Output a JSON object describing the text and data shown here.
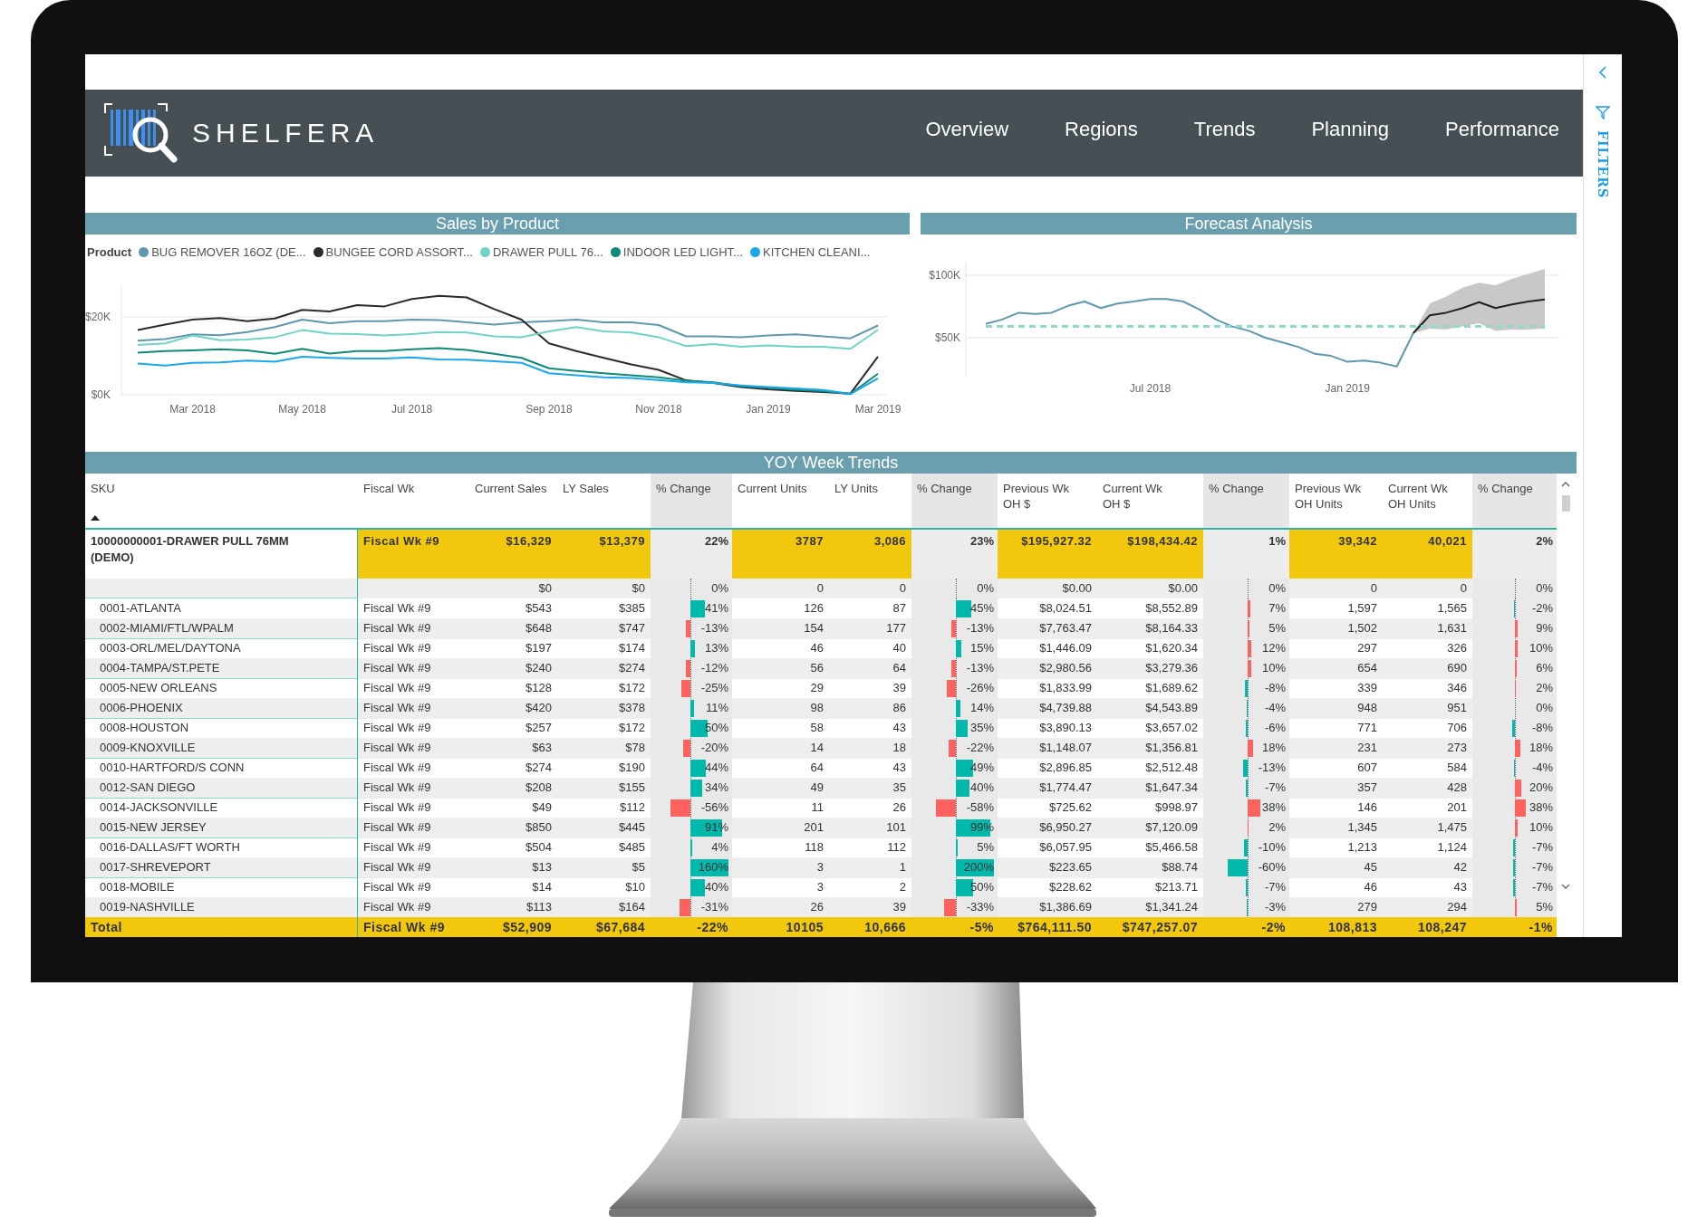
{
  "header": {
    "brand": "SHELFERA",
    "nav": [
      {
        "label": "Overview",
        "selected": false
      },
      {
        "label": "Regions",
        "selected": false
      },
      {
        "label": "Trends",
        "selected": false
      },
      {
        "label": "Planning",
        "selected": false
      },
      {
        "label": "Performance",
        "selected": false
      }
    ]
  },
  "side_panel": {
    "label": "FILTERS"
  },
  "sales_chart": {
    "title": "Sales by Product",
    "legend_title": "Product",
    "chart_data": {
      "type": "line",
      "categories": [
        null,
        null,
        "Mar 2018",
        null,
        null,
        null,
        "May 2018",
        null,
        null,
        null,
        "Jul 2018",
        null,
        null,
        null,
        null,
        "Sep 2018",
        null,
        null,
        null,
        "Nov 2018",
        null,
        null,
        null,
        "Jan 2019",
        null,
        null,
        null,
        "Mar 2019"
      ],
      "ylim": [
        0,
        28
      ],
      "yticks": [
        {
          "value": 0,
          "label": "$0K"
        },
        {
          "value": 20,
          "label": "$20K"
        }
      ],
      "series": [
        {
          "name": "BUG REMOVER 16OZ (DE...",
          "color": "#5f98ad",
          "values": [
            13.9,
            14.3,
            15.5,
            15.3,
            16.1,
            17.4,
            19.3,
            18.4,
            18.9,
            18.9,
            19.3,
            19.2,
            18.6,
            18,
            18.6,
            18.9,
            19.3,
            18.6,
            18.6,
            17.9,
            15,
            15,
            14.8,
            15.2,
            15.5,
            15,
            14.5,
            17.8
          ]
        },
        {
          "name": "BUNGEE CORD ASSORT...",
          "color": "#2b2b2b",
          "values": [
            16.6,
            18,
            19.3,
            19.7,
            18.9,
            19.6,
            21.8,
            21.4,
            23,
            22.7,
            24.6,
            25.4,
            25,
            22,
            19.3,
            13.2,
            11.2,
            9.5,
            7.8,
            6.4,
            3.7,
            3,
            2,
            1.4,
            1,
            0.7,
            0.3,
            9.8
          ]
        },
        {
          "name": "DRAWER PULL 76...",
          "color": "#6fd3c6",
          "values": [
            12.8,
            13.2,
            15.2,
            14,
            14.2,
            14.8,
            16.6,
            15.7,
            15.6,
            15.2,
            15.6,
            16.1,
            16,
            15,
            14.8,
            16.3,
            17.4,
            16.3,
            16,
            14.8,
            12.5,
            13,
            12.3,
            12.7,
            12.3,
            12.3,
            11.8,
            16.7
          ]
        },
        {
          "name": "INDOOR LED LIGHT...",
          "color": "#0f8a7a",
          "values": [
            10.8,
            11.2,
            11.4,
            11.7,
            11.4,
            10.5,
            11.8,
            10.6,
            11.2,
            11.2,
            11.7,
            12,
            11.5,
            10.5,
            9.5,
            6.8,
            6.1,
            5.5,
            5,
            4.5,
            3.6,
            3.2,
            2.2,
            1.8,
            1.3,
            0.9,
            0.2,
            5.4
          ]
        },
        {
          "name": "KITCHEN CLEANI...",
          "color": "#1aa7ec",
          "values": [
            8,
            7.5,
            8.2,
            8.3,
            8.8,
            8.5,
            9.8,
            9.5,
            9.3,
            9.3,
            9.6,
            9.1,
            9,
            8.6,
            8.2,
            5.5,
            5,
            4.5,
            4.3,
            3.8,
            3.2,
            3,
            2.4,
            2,
            1.6,
            1.2,
            0.2,
            4.2
          ]
        }
      ]
    }
  },
  "forecast_chart": {
    "title": "Forecast Analysis",
    "chart_data": {
      "type": "line",
      "categories": [
        null,
        null,
        null,
        null,
        null,
        null,
        null,
        null,
        null,
        null,
        "Jul 2018",
        null,
        null,
        null,
        null,
        null,
        null,
        null,
        null,
        null,
        null,
        null,
        "Jan 2019",
        null,
        null,
        null,
        null,
        null,
        null,
        null,
        null,
        null,
        null,
        null,
        null
      ],
      "ylim": [
        20,
        110
      ],
      "yticks": [
        {
          "value": 50,
          "label": "$50K"
        },
        {
          "value": 100,
          "label": "$100K"
        }
      ],
      "series": [
        {
          "color": "#5f98ad",
          "values": [
            61,
            64.6,
            70,
            69,
            70,
            75.5,
            79,
            73.7,
            77.4,
            79,
            81,
            81,
            79,
            72.6,
            64.6,
            59,
            55.5,
            50,
            46.4,
            42.7,
            37.2,
            35.4,
            30.7,
            31.7,
            30,
            27,
            53.6,
            null,
            null,
            null,
            null,
            null,
            null,
            null,
            null
          ]
        },
        {
          "color": "#222222",
          "values": [
            null,
            null,
            null,
            null,
            null,
            null,
            null,
            null,
            null,
            null,
            null,
            null,
            null,
            null,
            null,
            null,
            null,
            null,
            null,
            null,
            null,
            null,
            null,
            null,
            null,
            null,
            53.6,
            68,
            70,
            73.7,
            78.5,
            73.7,
            76.6,
            79,
            80.6
          ]
        },
        {
          "color": "#8fd8cc",
          "line_style": "dashed",
          "values": [
            59,
            59,
            59,
            59,
            59,
            59,
            59,
            59,
            59,
            59,
            59,
            59,
            59,
            59,
            59,
            59,
            59,
            59,
            59,
            59,
            59,
            59,
            59,
            59,
            59,
            59,
            59,
            59,
            59,
            59,
            59,
            59,
            59,
            59,
            59
          ]
        }
      ]
    }
  },
  "table": {
    "title": "YOY Week Trends",
    "columns": [
      {
        "label": "SKU",
        "kind": "text",
        "sorted": true
      },
      {
        "label": "Fiscal Wk",
        "kind": "text"
      },
      {
        "label": "Current Sales",
        "kind": "number"
      },
      {
        "label": "LY Sales",
        "kind": "number"
      },
      {
        "label": "% Change",
        "kind": "change",
        "inverted": false
      },
      {
        "label": "Current Units",
        "kind": "number"
      },
      {
        "label": "LY Units",
        "kind": "number"
      },
      {
        "label": "% Change",
        "kind": "change",
        "inverted": false
      },
      {
        "label": "Previous Wk\nOH $",
        "kind": "number"
      },
      {
        "label": "Current Wk\nOH $",
        "kind": "number"
      },
      {
        "label": "% Change",
        "kind": "change",
        "inverted": true
      },
      {
        "label": "Previous Wk\nOH Units",
        "kind": "number"
      },
      {
        "label": "Current Wk\nOH Units",
        "kind": "number"
      },
      {
        "label": "% Change",
        "kind": "change",
        "inverted": true
      }
    ],
    "rows": [
      {
        "kind": "group",
        "sku": "10000000001-DRAWER PULL 76MM (DEMO)",
        "fiscal_wk": "Fiscal Wk #9",
        "values": [
          "$16,329",
          "$13,379",
          {
            "text": "22%"
          },
          "3787",
          "3,086",
          {
            "text": "23%"
          },
          "$195,927.32",
          "$198,434.42",
          {
            "text": "1%"
          },
          "39,342",
          "40,021",
          {
            "text": "2%"
          }
        ]
      },
      {
        "kind": "detail",
        "values": [
          "$0",
          "$0",
          {
            "text": "0%"
          },
          "0",
          "0",
          {
            "text": "0%"
          },
          "$0.00",
          "$0.00",
          {
            "text": "0%"
          },
          "0",
          "0",
          {
            "text": "0%"
          }
        ]
      },
      {
        "kind": "detail",
        "sku": "0001-ATLANTA",
        "fiscal_wk": "Fiscal Wk #9",
        "values": [
          "$543",
          "$385",
          {
            "text": "41%",
            "negative": false
          },
          "126",
          "87",
          {
            "text": "45%",
            "negative": false
          },
          "$8,024.51",
          "$8,552.89",
          {
            "text": "7%",
            "negative": false
          },
          "1,597",
          "1,565",
          {
            "text": "-2%",
            "negative": true
          }
        ]
      },
      {
        "kind": "detail",
        "sku": "0002-MIAMI/FTL/WPALM",
        "fiscal_wk": "Fiscal Wk #9",
        "values": [
          "$648",
          "$747",
          {
            "text": "-13%",
            "negative": true
          },
          "154",
          "177",
          {
            "text": "-13%",
            "negative": true
          },
          "$7,763.47",
          "$8,164.33",
          {
            "text": "5%",
            "negative": false
          },
          "1,502",
          "1,631",
          {
            "text": "9%",
            "negative": false
          }
        ]
      },
      {
        "kind": "detail",
        "sku": "0003-ORL/MEL/DAYTONA",
        "fiscal_wk": "Fiscal Wk #9",
        "values": [
          "$197",
          "$174",
          {
            "text": "13%",
            "negative": false
          },
          "46",
          "40",
          {
            "text": "15%",
            "negative": false
          },
          "$1,446.09",
          "$1,620.34",
          {
            "text": "12%",
            "negative": false
          },
          "297",
          "326",
          {
            "text": "10%",
            "negative": false
          }
        ]
      },
      {
        "kind": "detail",
        "sku": "0004-TAMPA/ST.PETE",
        "fiscal_wk": "Fiscal Wk #9",
        "values": [
          "$240",
          "$274",
          {
            "text": "-12%",
            "negative": true
          },
          "56",
          "64",
          {
            "text": "-13%",
            "negative": true
          },
          "$2,980.56",
          "$3,279.36",
          {
            "text": "10%",
            "negative": false
          },
          "654",
          "690",
          {
            "text": "6%",
            "negative": false
          }
        ]
      },
      {
        "kind": "detail",
        "sku": "0005-NEW ORLEANS",
        "fiscal_wk": "Fiscal Wk #9",
        "values": [
          "$128",
          "$172",
          {
            "text": "-25%",
            "negative": true
          },
          "29",
          "39",
          {
            "text": "-26%",
            "negative": true
          },
          "$1,833.99",
          "$1,689.62",
          {
            "text": "-8%",
            "negative": true
          },
          "339",
          "346",
          {
            "text": "2%",
            "negative": false
          }
        ]
      },
      {
        "kind": "detail",
        "sku": "0006-PHOENIX",
        "fiscal_wk": "Fiscal Wk #9",
        "values": [
          "$420",
          "$378",
          {
            "text": "11%",
            "negative": false
          },
          "98",
          "86",
          {
            "text": "14%",
            "negative": false
          },
          "$4,739.88",
          "$4,543.89",
          {
            "text": "-4%",
            "negative": true
          },
          "948",
          "951",
          {
            "text": "0%"
          }
        ]
      },
      {
        "kind": "detail",
        "sku": "0008-HOUSTON",
        "fiscal_wk": "Fiscal Wk #9",
        "values": [
          "$257",
          "$172",
          {
            "text": "50%",
            "negative": false
          },
          "58",
          "43",
          {
            "text": "35%",
            "negative": false
          },
          "$3,890.13",
          "$3,657.02",
          {
            "text": "-6%",
            "negative": true
          },
          "771",
          "706",
          {
            "text": "-8%",
            "negative": true
          }
        ]
      },
      {
        "kind": "detail",
        "sku": "0009-KNOXVILLE",
        "fiscal_wk": "Fiscal Wk #9",
        "values": [
          "$63",
          "$78",
          {
            "text": "-20%",
            "negative": true
          },
          "14",
          "18",
          {
            "text": "-22%",
            "negative": true
          },
          "$1,148.07",
          "$1,356.81",
          {
            "text": "18%",
            "negative": false
          },
          "231",
          "273",
          {
            "text": "18%",
            "negative": false
          }
        ]
      },
      {
        "kind": "detail",
        "sku": "0010-HARTFORD/S CONN",
        "fiscal_wk": "Fiscal Wk #9",
        "values": [
          "$274",
          "$190",
          {
            "text": "44%",
            "negative": false
          },
          "64",
          "43",
          {
            "text": "49%",
            "negative": false
          },
          "$2,896.85",
          "$2,512.48",
          {
            "text": "-13%",
            "negative": true
          },
          "607",
          "584",
          {
            "text": "-4%",
            "negative": true
          }
        ]
      },
      {
        "kind": "detail",
        "sku": "0012-SAN DIEGO",
        "fiscal_wk": "Fiscal Wk #9",
        "values": [
          "$208",
          "$155",
          {
            "text": "34%",
            "negative": false
          },
          "49",
          "35",
          {
            "text": "40%",
            "negative": false
          },
          "$1,774.47",
          "$1,647.34",
          {
            "text": "-7%",
            "negative": true
          },
          "357",
          "428",
          {
            "text": "20%",
            "negative": false
          }
        ]
      },
      {
        "kind": "detail",
        "sku": "0014-JACKSONVILLE",
        "fiscal_wk": "Fiscal Wk #9",
        "values": [
          "$49",
          "$112",
          {
            "text": "-56%",
            "negative": true
          },
          "11",
          "26",
          {
            "text": "-58%",
            "negative": true
          },
          "$725.62",
          "$998.97",
          {
            "text": "38%",
            "negative": false
          },
          "146",
          "201",
          {
            "text": "38%",
            "negative": false
          }
        ]
      },
      {
        "kind": "detail",
        "sku": "0015-NEW JERSEY",
        "fiscal_wk": "Fiscal Wk #9",
        "values": [
          "$850",
          "$445",
          {
            "text": "91%",
            "negative": false
          },
          "201",
          "101",
          {
            "text": "99%",
            "negative": false
          },
          "$6,950.27",
          "$7,120.09",
          {
            "text": "2%",
            "negative": false
          },
          "1,345",
          "1,475",
          {
            "text": "10%",
            "negative": false
          }
        ]
      },
      {
        "kind": "detail",
        "sku": "0016-DALLAS/FT WORTH",
        "fiscal_wk": "Fiscal Wk #9",
        "values": [
          "$504",
          "$485",
          {
            "text": "4%",
            "negative": false
          },
          "118",
          "112",
          {
            "text": "5%",
            "negative": false
          },
          "$6,057.95",
          "$5,466.58",
          {
            "text": "-10%",
            "negative": true
          },
          "1,213",
          "1,124",
          {
            "text": "-7%",
            "negative": true
          }
        ]
      },
      {
        "kind": "detail",
        "sku": "0017-SHREVEPORT",
        "fiscal_wk": "Fiscal Wk #9",
        "values": [
          "$13",
          "$5",
          {
            "text": "160%",
            "negative": false
          },
          "3",
          "1",
          {
            "text": "200%",
            "negative": false
          },
          "$223.65",
          "$88.74",
          {
            "text": "-60%",
            "negative": true
          },
          "45",
          "42",
          {
            "text": "-7%",
            "negative": true
          }
        ]
      },
      {
        "kind": "detail",
        "sku": "0018-MOBILE",
        "fiscal_wk": "Fiscal Wk #9",
        "values": [
          "$14",
          "$10",
          {
            "text": "40%",
            "negative": false
          },
          "3",
          "2",
          {
            "text": "50%",
            "negative": false
          },
          "$228.62",
          "$213.71",
          {
            "text": "-7%",
            "negative": true
          },
          "46",
          "43",
          {
            "text": "-7%",
            "negative": true
          }
        ]
      },
      {
        "kind": "detail",
        "sku": "0019-NASHVILLE",
        "fiscal_wk": "Fiscal Wk #9",
        "values": [
          "$113",
          "$164",
          {
            "text": "-31%",
            "negative": true
          },
          "26",
          "39",
          {
            "text": "-33%",
            "negative": true
          },
          "$1,386.69",
          "$1,341.24",
          {
            "text": "-3%",
            "negative": true
          },
          "279",
          "294",
          {
            "text": "5%",
            "negative": false
          }
        ]
      },
      {
        "kind": "total",
        "sku": "Total",
        "fiscal_wk": "Fiscal Wk #9",
        "values": [
          "$52,909",
          "$67,684",
          {
            "text": "-22%"
          },
          "10105",
          "10,666",
          {
            "text": "-5%"
          },
          "$764,111.50",
          "$747,257.07",
          {
            "text": "-2%"
          },
          "108,813",
          "108,247",
          {
            "text": "-1%"
          }
        ]
      }
    ]
  }
}
